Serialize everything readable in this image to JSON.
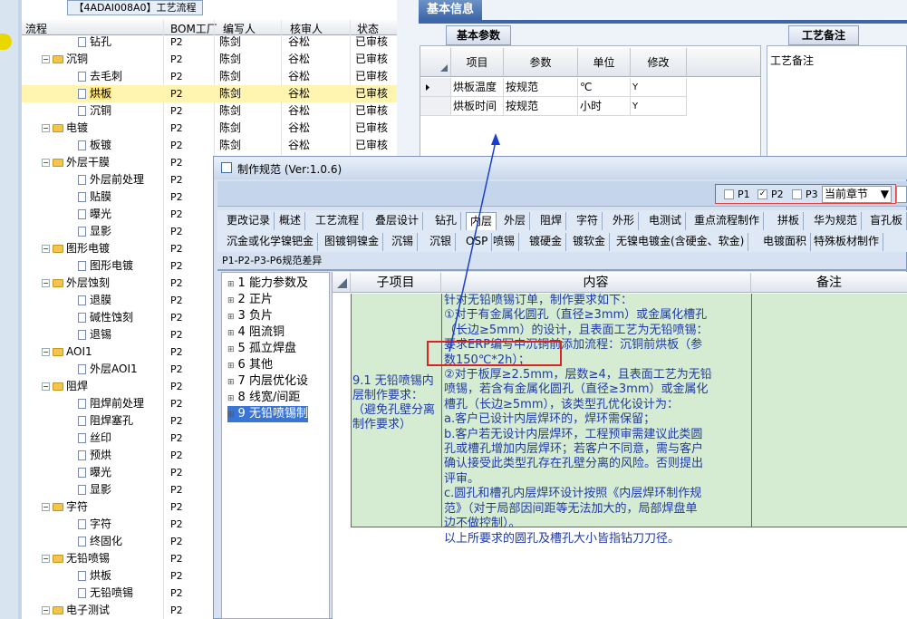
{
  "tree_panel": {
    "title": "【4ADAI008A0】工艺流程",
    "headers": {
      "process": "流程",
      "bom": "BOM工厂",
      "author": "编写人",
      "reviewer": "核审人",
      "status": "状态"
    },
    "rows": [
      {
        "indent": 2,
        "kind": "doc",
        "name": "钻孔",
        "bom": "P2",
        "author": "陈剑",
        "reviewer": "谷松",
        "status": "已审核"
      },
      {
        "indent": 1,
        "kind": "folder",
        "name": "沉铜",
        "bom": "P2",
        "author": "陈剑",
        "reviewer": "谷松",
        "status": "已审核"
      },
      {
        "indent": 2,
        "kind": "doc",
        "name": "去毛刺",
        "bom": "P2",
        "author": "陈剑",
        "reviewer": "谷松",
        "status": "已审核"
      },
      {
        "indent": 2,
        "kind": "doc",
        "name": "烘板",
        "bom": "P2",
        "author": "陈剑",
        "reviewer": "谷松",
        "status": "已审核",
        "selected": true
      },
      {
        "indent": 2,
        "kind": "doc",
        "name": "沉铜",
        "bom": "P2",
        "author": "陈剑",
        "reviewer": "谷松",
        "status": "已审核"
      },
      {
        "indent": 1,
        "kind": "folder",
        "name": "电镀",
        "bom": "P2",
        "author": "陈剑",
        "reviewer": "谷松",
        "status": "已审核"
      },
      {
        "indent": 2,
        "kind": "doc",
        "name": "板镀",
        "bom": "P2",
        "author": "陈剑",
        "reviewer": "谷松",
        "status": "已审核"
      },
      {
        "indent": 1,
        "kind": "folder",
        "name": "外层干膜",
        "bom": "P2",
        "author": "",
        "reviewer": "",
        "status": ""
      },
      {
        "indent": 2,
        "kind": "doc",
        "name": "外层前处理",
        "bom": "P2",
        "author": "",
        "reviewer": "",
        "status": ""
      },
      {
        "indent": 2,
        "kind": "doc",
        "name": "贴膜",
        "bom": "P2",
        "author": "",
        "reviewer": "",
        "status": ""
      },
      {
        "indent": 2,
        "kind": "doc",
        "name": "曝光",
        "bom": "P2",
        "author": "",
        "reviewer": "",
        "status": ""
      },
      {
        "indent": 2,
        "kind": "doc",
        "name": "显影",
        "bom": "P2",
        "author": "",
        "reviewer": "",
        "status": ""
      },
      {
        "indent": 1,
        "kind": "folder",
        "name": "图形电镀",
        "bom": "P2",
        "author": "",
        "reviewer": "",
        "status": ""
      },
      {
        "indent": 2,
        "kind": "doc",
        "name": "图形电镀",
        "bom": "P2",
        "author": "",
        "reviewer": "",
        "status": ""
      },
      {
        "indent": 1,
        "kind": "folder",
        "name": "外层蚀刻",
        "bom": "P2",
        "author": "",
        "reviewer": "",
        "status": ""
      },
      {
        "indent": 2,
        "kind": "doc",
        "name": "退膜",
        "bom": "P2",
        "author": "",
        "reviewer": "",
        "status": ""
      },
      {
        "indent": 2,
        "kind": "doc",
        "name": "碱性蚀刻",
        "bom": "P2",
        "author": "",
        "reviewer": "",
        "status": ""
      },
      {
        "indent": 2,
        "kind": "doc",
        "name": "退锡",
        "bom": "P2",
        "author": "",
        "reviewer": "",
        "status": ""
      },
      {
        "indent": 1,
        "kind": "folder",
        "name": "AOI1",
        "bom": "P2",
        "author": "",
        "reviewer": "",
        "status": ""
      },
      {
        "indent": 2,
        "kind": "doc",
        "name": "外层AOI1",
        "bom": "P2",
        "author": "",
        "reviewer": "",
        "status": ""
      },
      {
        "indent": 1,
        "kind": "folder",
        "name": "阻焊",
        "bom": "P2",
        "author": "",
        "reviewer": "",
        "status": ""
      },
      {
        "indent": 2,
        "kind": "doc",
        "name": "阻焊前处理",
        "bom": "P2",
        "author": "",
        "reviewer": "",
        "status": ""
      },
      {
        "indent": 2,
        "kind": "doc",
        "name": "阻焊塞孔",
        "bom": "P2",
        "author": "",
        "reviewer": "",
        "status": ""
      },
      {
        "indent": 2,
        "kind": "doc",
        "name": "丝印",
        "bom": "P2",
        "author": "",
        "reviewer": "",
        "status": ""
      },
      {
        "indent": 2,
        "kind": "doc",
        "name": "预烘",
        "bom": "P2",
        "author": "",
        "reviewer": "",
        "status": ""
      },
      {
        "indent": 2,
        "kind": "doc",
        "name": "曝光",
        "bom": "P2",
        "author": "",
        "reviewer": "",
        "status": ""
      },
      {
        "indent": 2,
        "kind": "doc",
        "name": "显影",
        "bom": "P2",
        "author": "",
        "reviewer": "",
        "status": ""
      },
      {
        "indent": 1,
        "kind": "folder",
        "name": "字符",
        "bom": "P2",
        "author": "",
        "reviewer": "",
        "status": ""
      },
      {
        "indent": 2,
        "kind": "doc",
        "name": "字符",
        "bom": "P2",
        "author": "",
        "reviewer": "",
        "status": ""
      },
      {
        "indent": 2,
        "kind": "doc",
        "name": "终固化",
        "bom": "P2",
        "author": "",
        "reviewer": "",
        "status": ""
      },
      {
        "indent": 1,
        "kind": "folder",
        "name": "无铅喷锡",
        "bom": "P2",
        "author": "",
        "reviewer": "",
        "status": ""
      },
      {
        "indent": 2,
        "kind": "doc",
        "name": "烘板",
        "bom": "P2",
        "author": "",
        "reviewer": "",
        "status": ""
      },
      {
        "indent": 2,
        "kind": "doc",
        "name": "无铅喷锡",
        "bom": "P2",
        "author": "",
        "reviewer": "",
        "status": ""
      },
      {
        "indent": 1,
        "kind": "folder",
        "name": "电子测试",
        "bom": "P2",
        "author": "",
        "reviewer": "",
        "status": ""
      }
    ]
  },
  "info": {
    "tab_label": "基本信息",
    "basic_tab": "基本参数",
    "remark_tab": "工艺备注",
    "remark_label": "工艺备注",
    "param_headers": {
      "item": "项目",
      "param": "参数",
      "unit": "单位",
      "modify": "修改"
    },
    "param_rows": [
      {
        "item": "烘板温度",
        "param": "按规范",
        "unit": "℃",
        "modify": "Y"
      },
      {
        "item": "烘板时间",
        "param": "按规范",
        "unit": "小时",
        "modify": "Y"
      }
    ]
  },
  "dialog": {
    "title": "制作规范 (Ver:1.0.6)",
    "p1": "P1",
    "p2": "P2",
    "p3": "P3",
    "chapter_select": "当前章节",
    "tabs_row1": [
      "更改记录",
      "概述",
      "工艺流程",
      "叠层设计",
      "钻孔",
      "内层",
      "外层",
      "阻焊",
      "字符",
      "外形",
      "电测试",
      "重点流程制作",
      "拼板",
      "华为规范",
      "盲孔板"
    ],
    "tabs_row2": [
      "沉金或化学镍钯金",
      "图镀铜镍金",
      "沉锡",
      "沉银",
      "OSP",
      "喷锡",
      "镀硬金",
      "镀软金",
      "无镍电镀金(含硬金、软金)",
      "电镀面积",
      "特殊板材制作"
    ],
    "sub_tab": "P1-P2-P3-P6规范差异",
    "tree_items": [
      {
        "num": "1",
        "label": "能力参数及"
      },
      {
        "num": "2",
        "label": "正片"
      },
      {
        "num": "3",
        "label": "负片"
      },
      {
        "num": "4",
        "label": "阻流铜"
      },
      {
        "num": "5",
        "label": "孤立焊盘"
      },
      {
        "num": "6",
        "label": "其他"
      },
      {
        "num": "7",
        "label": "内层优化设"
      },
      {
        "num": "8",
        "label": "线宽/间距"
      },
      {
        "num": "9",
        "label": "无铅喷锡制"
      }
    ],
    "grid_headers": {
      "sub": "子项目",
      "content": "内容",
      "remark": "备注"
    },
    "row_sub": "9.1 无铅喷锡内层制作要求：（避免孔壁分离制作要求）",
    "row_content_lines": [
      "针对无铅喷锡订单，制作要求如下：",
      "①对于有金属化圆孔（直径≥3mm）或金属化槽孔",
      "（长边≥5mm）的设计，且表面工艺为无铅喷锡：",
      "要求ERP编写中沉铜前添加流程：沉铜前烘板（参",
      "数150℃*2h）；",
      "②对于板厚≥2.5mm，层数≥4，且表面工艺为无铅",
      "喷锡，若含有金属化圆孔（直径≥3mm）或金属化",
      "槽孔（长边≥5mm），该类型孔优化设计为：",
      "a.客户已设计内层焊环的，焊环需保留；",
      "b.客户若无设计内层焊环，工程预审需建议此类圆",
      "孔或槽孔增加内层焊环；若客户不同意，需与客户",
      "确认接受此类型孔存在孔壁分离的风险。否则提出",
      "评审。",
      "c.圆孔和槽孔内层焊环设计按照《内层焊环制作规",
      "范》（对于局部因间距等无法加大的，局部焊盘单",
      "边不做控制）。",
      "以上所要求的圆孔及槽孔大小皆指钻刀刀径。"
    ]
  },
  "colors": {
    "accent": "#3c66a8",
    "selected_row": "#ffe47a",
    "content_bg": "#d6ecd2",
    "highlight_red": "#d22",
    "arrow_blue": "#1a3fd0"
  }
}
